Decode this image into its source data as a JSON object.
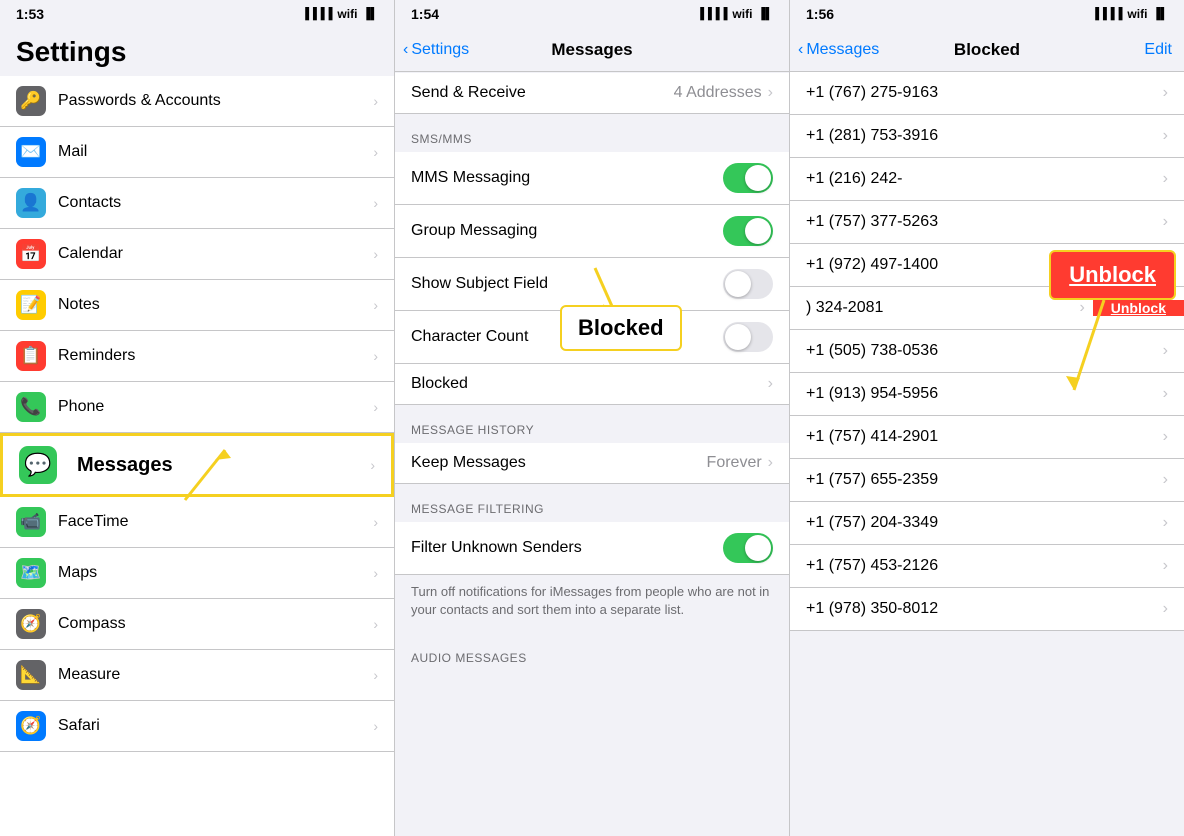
{
  "panel1": {
    "status": {
      "time": "1:53",
      "signal": true,
      "wifi": true,
      "battery": "charging"
    },
    "title": "Settings",
    "items": [
      {
        "id": "passwords",
        "label": "Passwords & Accounts",
        "icon": "🔑",
        "iconBg": "#636366"
      },
      {
        "id": "mail",
        "label": "Mail",
        "icon": "✉️",
        "iconBg": "#007aff"
      },
      {
        "id": "contacts",
        "label": "Contacts",
        "icon": "👤",
        "iconBg": "#34aadc"
      },
      {
        "id": "calendar",
        "label": "Calendar",
        "icon": "📅",
        "iconBg": "#ff3b30"
      },
      {
        "id": "notes",
        "label": "Notes",
        "icon": "📝",
        "iconBg": "#ffcc00"
      },
      {
        "id": "reminders",
        "label": "Reminders",
        "icon": "📋",
        "iconBg": "#ff3b30"
      },
      {
        "id": "phone",
        "label": "Phone",
        "icon": "📞",
        "iconBg": "#34c759"
      },
      {
        "id": "messages",
        "label": "Messages",
        "icon": "💬",
        "iconBg": "#34c759"
      },
      {
        "id": "facetime",
        "label": "FaceTime",
        "icon": "📹",
        "iconBg": "#34c759"
      },
      {
        "id": "maps",
        "label": "Maps",
        "icon": "🗺️",
        "iconBg": "#34c759"
      },
      {
        "id": "compass",
        "label": "Compass",
        "icon": "🧭",
        "iconBg": "#636366"
      },
      {
        "id": "measure",
        "label": "Measure",
        "icon": "📐",
        "iconBg": "#636366"
      },
      {
        "id": "safari",
        "label": "Safari",
        "icon": "🧭",
        "iconBg": "#007aff"
      }
    ],
    "annotation": {
      "label": "Messages",
      "arrow": true
    }
  },
  "panel2": {
    "status": {
      "time": "1:54"
    },
    "nav": {
      "back": "Settings",
      "title": "Messages"
    },
    "topRow": {
      "label": "Send & Receive",
      "value": "4 Addresses"
    },
    "sectionSMS": "SMS/MMS",
    "smsRows": [
      {
        "id": "mms",
        "label": "MMS Messaging",
        "toggle": true,
        "on": true
      },
      {
        "id": "group",
        "label": "Group Messaging",
        "toggle": true,
        "on": true
      },
      {
        "id": "subject",
        "label": "Show Subject Field",
        "toggle": true,
        "on": false
      },
      {
        "id": "charcount",
        "label": "Character Count",
        "toggle": true,
        "on": false
      },
      {
        "id": "blocked",
        "label": "Blocked",
        "toggle": false,
        "chevron": true
      }
    ],
    "sectionHistory": "MESSAGE HISTORY",
    "historyRows": [
      {
        "id": "keep",
        "label": "Keep Messages",
        "value": "Forever",
        "chevron": true
      }
    ],
    "sectionFiltering": "MESSAGE FILTERING",
    "filterRows": [
      {
        "id": "filter",
        "label": "Filter Unknown Senders",
        "toggle": true,
        "on": true
      }
    ],
    "filterDescription": "Turn off notifications for iMessages from people who are not in your contacts and sort them into a separate list.",
    "sectionAudio": "AUDIO MESSAGES",
    "annotation": {
      "label": "Blocked",
      "arrow": true
    }
  },
  "panel3": {
    "status": {
      "time": "1:56"
    },
    "nav": {
      "back": "Messages",
      "title": "Blocked",
      "edit": "Edit"
    },
    "numbers": [
      {
        "id": "n1",
        "label": "+1 (767) 275-9163",
        "full": true
      },
      {
        "id": "n2",
        "label": "+1 (281) 753-3916",
        "full": true
      },
      {
        "id": "n3",
        "label": "+1 (216) 242-",
        "full": false,
        "unblock": true
      },
      {
        "id": "n4",
        "label": "+1 (757) 377-5263",
        "full": true
      },
      {
        "id": "n5",
        "label": "+1 (972) 497-1400",
        "full": true
      },
      {
        "id": "n6",
        "label": ") 324-2081",
        "full": false,
        "swiped": true
      },
      {
        "id": "n7",
        "label": "+1 (505) 738-0536",
        "full": true
      },
      {
        "id": "n8",
        "label": "+1 (913) 954-5956",
        "full": true
      },
      {
        "id": "n9",
        "label": "+1 (757) 414-2901",
        "full": true
      },
      {
        "id": "n10",
        "label": "+1 (757) 655-2359",
        "full": true
      },
      {
        "id": "n11",
        "label": "+1 (757) 204-3349",
        "full": true
      },
      {
        "id": "n12",
        "label": "+1 (757) 453-2126",
        "full": true
      },
      {
        "id": "n13",
        "label": "+1 (978) 350-8012",
        "full": false
      }
    ],
    "unblockLabel": "Unblock"
  }
}
